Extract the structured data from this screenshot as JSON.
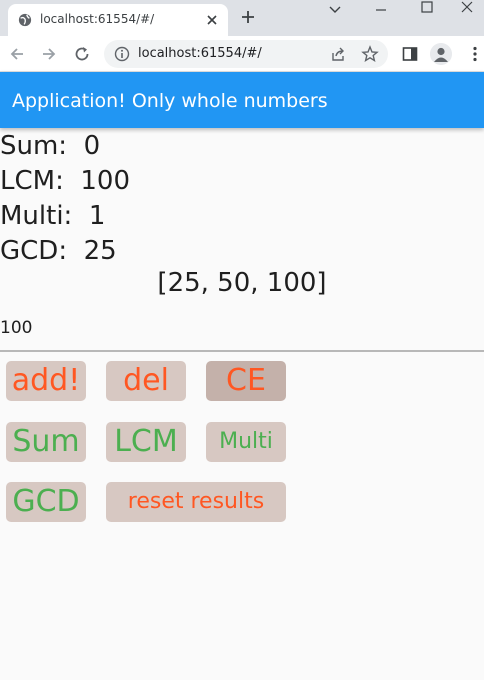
{
  "browser": {
    "tab_title": "localhost:61554/#/",
    "url": "localhost:61554/#/"
  },
  "app": {
    "title": "Application! Only whole numbers"
  },
  "results": {
    "sum_label": "Sum:",
    "sum_value": "0",
    "lcm_label": "LCM:",
    "lcm_value": "100",
    "multi_label": "Multi:",
    "multi_value": "1",
    "gcd_label": "GCD:",
    "gcd_value": "25",
    "numbers_list": "[25, 50, 100]",
    "input_value": "100"
  },
  "buttons": {
    "add": "add!",
    "del": "del",
    "ce": "CE",
    "sum": "Sum",
    "lcm": "LCM",
    "multi": "Multi",
    "gcd": "GCD",
    "reset": "reset results"
  },
  "colors": {
    "appbar": "#2196f3",
    "button_bg": "#d7c8c2",
    "orange_text": "#ff5722",
    "green_text": "#4caf50"
  }
}
